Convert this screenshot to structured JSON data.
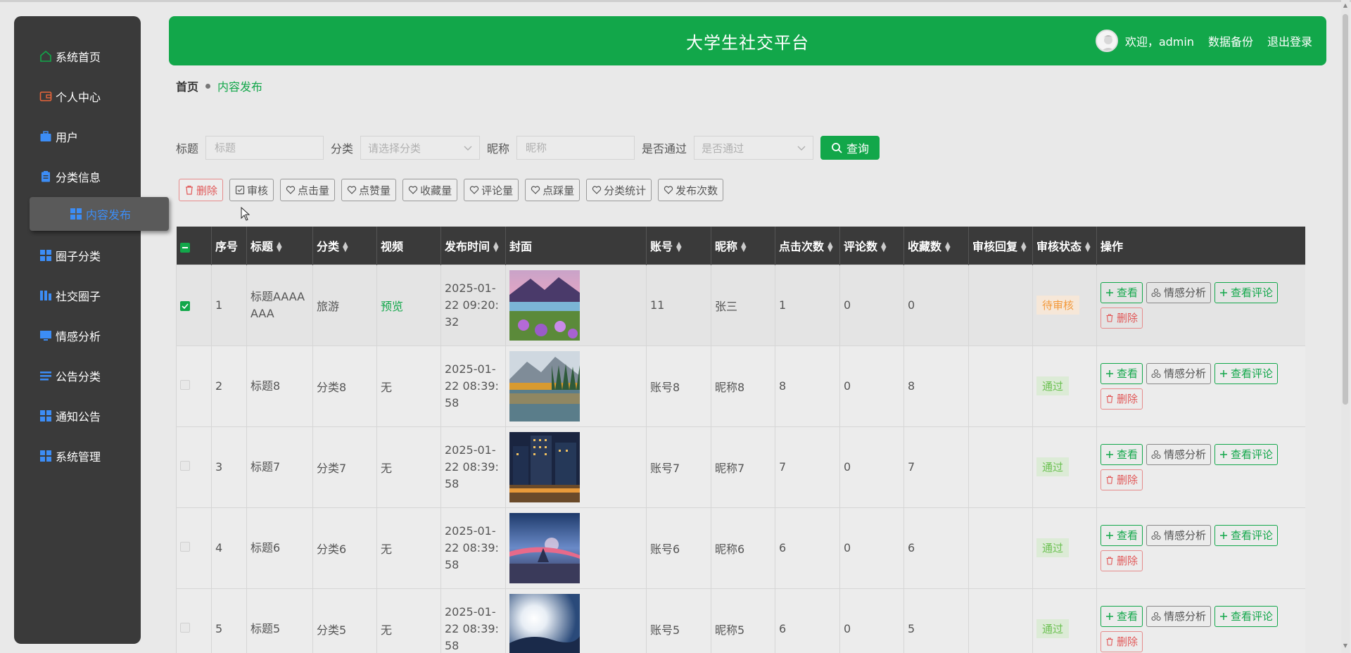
{
  "app": {
    "title": "大学生社交平台",
    "welcome": "欢迎，admin",
    "backup": "数据备份",
    "logout": "退出登录",
    "accent": "#12a74a",
    "sidebar_bg": "#3a3a3a"
  },
  "sidebar": {
    "items": [
      {
        "label": "系统首页",
        "icon": "home-icon"
      },
      {
        "label": "个人中心",
        "icon": "wallet-icon"
      },
      {
        "label": "用户",
        "icon": "briefcase-icon"
      },
      {
        "label": "分类信息",
        "icon": "clipboard-icon"
      },
      {
        "label": "内容发布",
        "icon": "grid-icon",
        "active": true
      },
      {
        "label": "圈子分类",
        "icon": "grid-icon"
      },
      {
        "label": "社交圈子",
        "icon": "bars-icon"
      },
      {
        "label": "情感分析",
        "icon": "monitor-icon"
      },
      {
        "label": "公告分类",
        "icon": "list-icon"
      },
      {
        "label": "通知公告",
        "icon": "grid-icon"
      },
      {
        "label": "系统管理",
        "icon": "grid-icon"
      }
    ]
  },
  "breadcrumb": {
    "home": "首页",
    "current": "内容发布"
  },
  "search": {
    "title_label": "标题",
    "title_placeholder": "标题",
    "category_label": "分类",
    "category_placeholder": "请选择分类",
    "nickname_label": "昵称",
    "nickname_placeholder": "昵称",
    "pass_label": "是否通过",
    "pass_placeholder": "是否通过",
    "query": "查询"
  },
  "toolbar": {
    "delete": "删除",
    "audit": "审核",
    "clicks": "点击量",
    "likes": "点赞量",
    "favorites": "收藏量",
    "comments": "评论量",
    "dislikes": "点踩量",
    "category_stats": "分类统计",
    "publish_count": "发布次数"
  },
  "table": {
    "headers": {
      "index": "序号",
      "title": "标题",
      "category": "分类",
      "video": "视频",
      "time": "发布时间",
      "cover": "封面",
      "account": "账号",
      "nickname": "昵称",
      "clicks": "点击次数",
      "comments": "评论数",
      "favorites": "收藏数",
      "reply": "审核回复",
      "status": "审核状态",
      "ops": "操作"
    },
    "ops": {
      "view": "查看",
      "sentiment": "情感分析",
      "view_comments": "查看评论",
      "delete": "删除"
    },
    "rows": [
      {
        "index": "1",
        "title": "标题AAAAAAA",
        "category": "旅游",
        "video": "预览",
        "time": "2025-01-22 09:20:32",
        "account": "11",
        "nickname": "张三",
        "clicks": "1",
        "comments": "0",
        "favorites": "0",
        "reply": "",
        "status": "待审核",
        "checked": true
      },
      {
        "index": "2",
        "title": "标题8",
        "category": "分类8",
        "video": "无",
        "time": "2025-01-22 08:39:58",
        "account": "账号8",
        "nickname": "昵称8",
        "clicks": "8",
        "comments": "0",
        "favorites": "8",
        "reply": "",
        "status": "通过"
      },
      {
        "index": "3",
        "title": "标题7",
        "category": "分类7",
        "video": "无",
        "time": "2025-01-22 08:39:58",
        "account": "账号7",
        "nickname": "昵称7",
        "clicks": "7",
        "comments": "0",
        "favorites": "7",
        "reply": "",
        "status": "通过"
      },
      {
        "index": "4",
        "title": "标题6",
        "category": "分类6",
        "video": "无",
        "time": "2025-01-22 08:39:58",
        "account": "账号6",
        "nickname": "昵称6",
        "clicks": "6",
        "comments": "0",
        "favorites": "6",
        "reply": "",
        "status": "通过"
      },
      {
        "index": "5",
        "title": "标题5",
        "category": "分类5",
        "video": "无",
        "time": "2025-01-22 08:39:58",
        "account": "账号5",
        "nickname": "昵称5",
        "clicks": "6",
        "comments": "0",
        "favorites": "5",
        "reply": "",
        "status": "通过"
      }
    ]
  }
}
